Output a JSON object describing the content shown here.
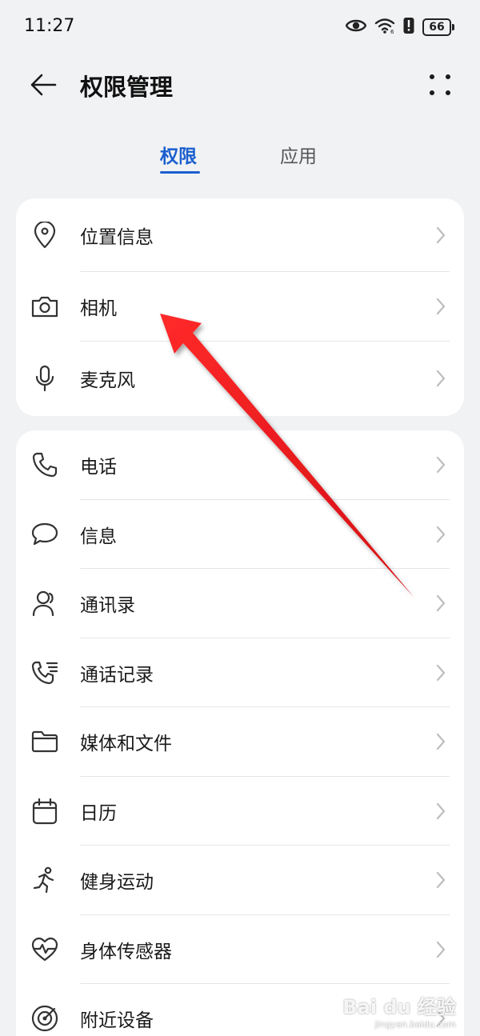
{
  "status_bar": {
    "time": "11:27",
    "battery": "66",
    "icons": [
      "eye-icon",
      "wifi-icon",
      "alert-icon",
      "battery-icon"
    ]
  },
  "header": {
    "title": "权限管理",
    "back_icon": "back-arrow-icon",
    "more_icon": "more-dots-icon"
  },
  "tabs": [
    {
      "label": "权限",
      "active": true
    },
    {
      "label": "应用",
      "active": false
    }
  ],
  "card1": {
    "items": [
      {
        "label": "位置信息",
        "icon": "location-icon"
      },
      {
        "label": "相机",
        "icon": "camera-icon"
      },
      {
        "label": "麦克风",
        "icon": "microphone-icon"
      }
    ]
  },
  "card2": {
    "items": [
      {
        "label": "电话",
        "icon": "phone-icon"
      },
      {
        "label": "信息",
        "icon": "message-icon"
      },
      {
        "label": "通讯录",
        "icon": "contacts-icon"
      },
      {
        "label": "通话记录",
        "icon": "call-log-icon"
      },
      {
        "label": "媒体和文件",
        "icon": "folder-icon"
      },
      {
        "label": "日历",
        "icon": "calendar-icon"
      },
      {
        "label": "健身运动",
        "icon": "running-icon"
      },
      {
        "label": "身体传感器",
        "icon": "heart-rate-icon"
      },
      {
        "label": "附近设备",
        "icon": "nearby-devices-icon"
      }
    ]
  },
  "colors": {
    "accent": "#1b5fce",
    "background": "#f1f2f4",
    "card": "#ffffff",
    "annotation_arrow": "#e8141c"
  },
  "watermark": {
    "logo": "Bai du 经验",
    "sub": "jingyan.baidu.com"
  }
}
